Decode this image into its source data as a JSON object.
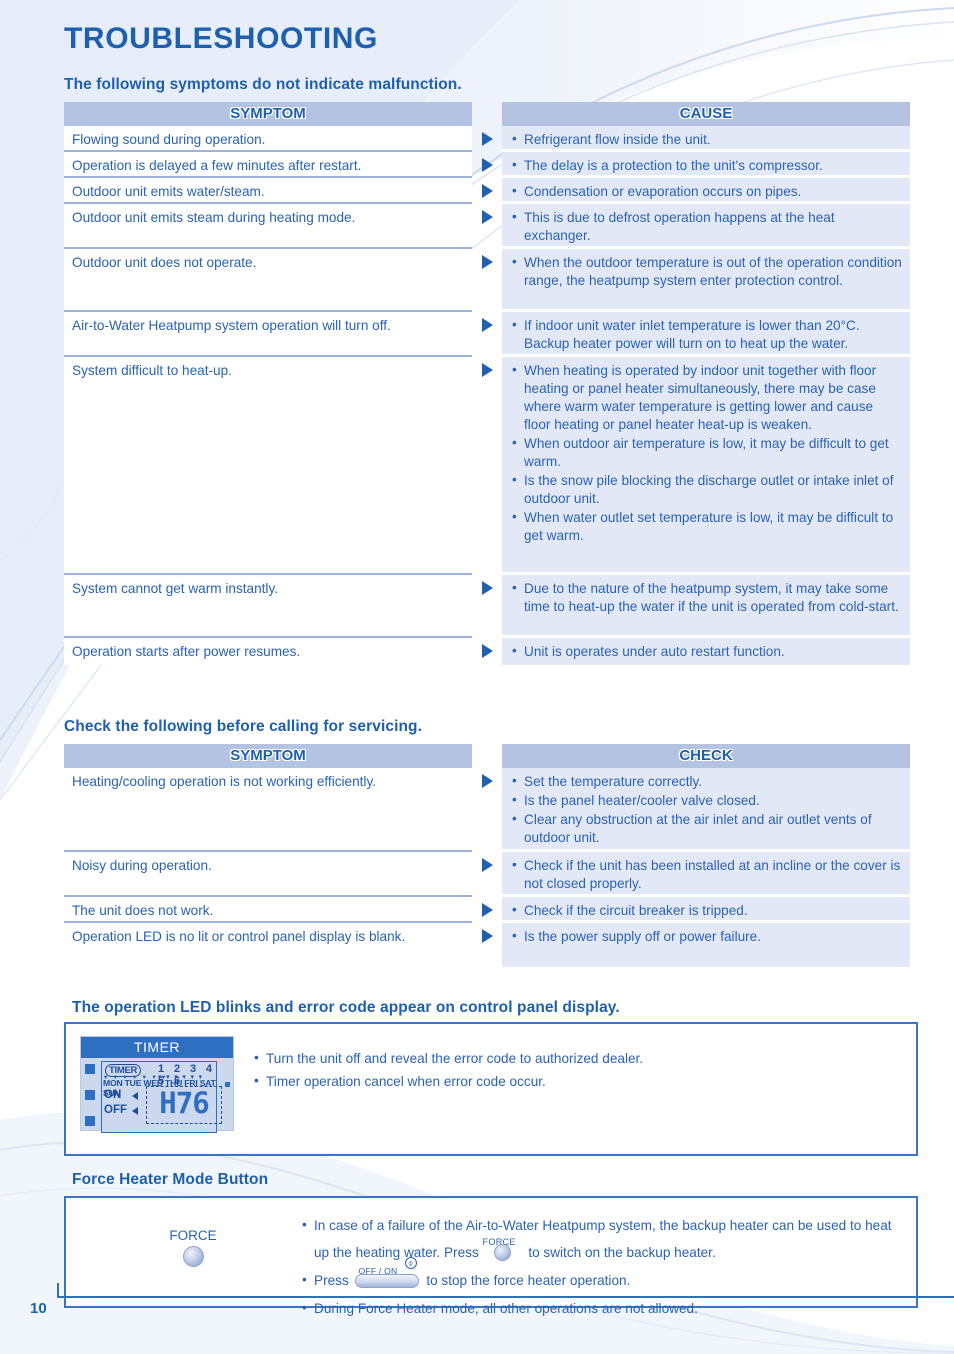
{
  "page": {
    "title": "TROUBLESHOOTING",
    "number": "10"
  },
  "section1": {
    "heading": "The following symptoms do not indicate malfunction.",
    "symptom_header": "SYMPTOM",
    "cause_header": "CAUSE",
    "rows": [
      {
        "symptom": "Flowing sound during operation.",
        "causes": [
          "Refrigerant flow inside the unit."
        ]
      },
      {
        "symptom": "Operation is delayed a few minutes after restart.",
        "causes": [
          "The delay is a protection to the unit's compressor."
        ]
      },
      {
        "symptom": "Outdoor unit emits water/steam.",
        "causes": [
          "Condensation or evaporation occurs on pipes."
        ]
      },
      {
        "symptom": "Outdoor unit emits steam during heating mode.",
        "causes": [
          "This is due to defrost operation happens at the heat exchanger."
        ]
      },
      {
        "symptom": "Outdoor unit does not operate.",
        "causes": [
          "When the outdoor temperature is out of the operation condition range, the heatpump system enter protection control."
        ]
      },
      {
        "symptom": "Air-to-Water Heatpump system operation will turn off.",
        "causes": [
          "If indoor unit water inlet temperature is lower than 20°C. Backup heater power will turn on to heat up the water."
        ]
      },
      {
        "symptom": "System difficult to heat-up.",
        "causes": [
          "When heating is operated by indoor unit together with floor heating or panel heater simultaneously, there may be case where warm water temperature is getting lower and cause floor heating or panel heater heat-up is weaken.",
          "When outdoor air temperature is low, it may be difficult to get warm.",
          "Is the snow pile blocking the discharge outlet or intake inlet of outdoor unit.",
          "When water outlet set temperature is low, it may be difficult to get warm."
        ]
      },
      {
        "symptom": "System cannot get warm instantly.",
        "causes": [
          "Due to the nature of the heatpump system, it may take some time to heat-up the water if the unit is operated from cold-start."
        ]
      },
      {
        "symptom": "Operation starts after power resumes.",
        "causes": [
          "Unit is operates under auto restart function."
        ]
      }
    ]
  },
  "section2": {
    "heading": "Check the following before calling for servicing.",
    "symptom_header": "SYMPTOM",
    "check_header": "CHECK",
    "rows": [
      {
        "symptom": "Heating/cooling operation is not working efficiently.",
        "checks": [
          "Set the temperature correctly.",
          "Is the panel heater/cooler valve closed.",
          "Clear any obstruction at the air inlet and air outlet vents of outdoor unit."
        ]
      },
      {
        "symptom": "Noisy during operation.",
        "checks": [
          "Check if the unit has been installed at an incline or the cover is not closed properly."
        ]
      },
      {
        "symptom": "The unit does not work.",
        "checks": [
          "Check if the circuit breaker is tripped."
        ]
      },
      {
        "symptom": "Operation LED is no lit or control panel display is blank.",
        "checks": [
          "Is the power supply off or power failure."
        ]
      }
    ]
  },
  "section3": {
    "heading": "The operation LED blinks and error code appear on control panel display.",
    "notes": [
      "Turn the unit off and reveal the error code to authorized dealer.",
      "Timer operation cancel when error code occur."
    ],
    "lcd": {
      "title": "TIMER",
      "timer_tag": "TIMER",
      "numbers": "1 2 3 4 5 6",
      "days": "MON TUE WED THU FRI SAT SUN",
      "on_label": "ON",
      "off_label": "OFF",
      "error_code": "H76"
    }
  },
  "section4": {
    "heading": "Force Heater Mode Button",
    "button_label": "FORCE",
    "notes": [
      {
        "pre": "In case of a failure of the Air-to-Water Heatpump system, the backup heater can be used to heat up the heating water. Press",
        "icon": "force-button-icon",
        "icon_label": "FORCE",
        "post": "to switch on the backup heater."
      },
      {
        "pre": "Press",
        "icon": "off-on-button-icon",
        "icon_label": "OFF / ON",
        "post": "to stop the force heater operation."
      },
      {
        "pre": "During Force Heater mode, all other operations are not allowed.",
        "icon": "",
        "icon_label": "",
        "post": ""
      }
    ]
  },
  "colors": {
    "brand_blue": "#1e5fae",
    "text_blue": "#2a62b4",
    "header_band": "#b4c3e2",
    "cause_bg": "#e3e8f6",
    "rule": "#9fb4da"
  }
}
